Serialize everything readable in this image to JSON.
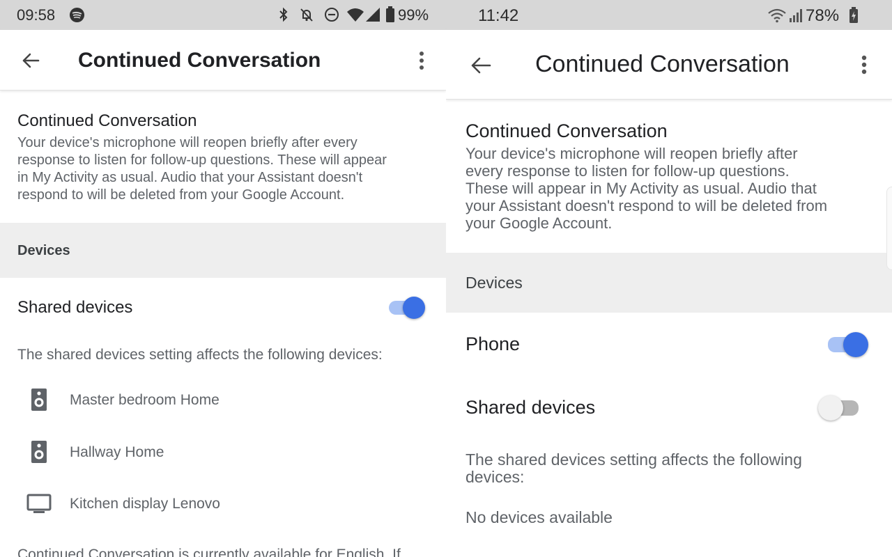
{
  "left": {
    "status": {
      "time": "09:58",
      "battery": "99%"
    },
    "toolbar": {
      "title": "Continued Conversation"
    },
    "section": {
      "heading": "Continued Conversation",
      "description_lines": [
        "Your device's microphone will reopen briefly after every",
        "response to listen for follow-up questions. These will appear",
        "in My Activity as usual. Audio that your Assistant doesn't",
        "respond to will be deleted from your Google Account."
      ]
    },
    "devices_header": "Devices",
    "shared_devices": {
      "label": "Shared devices",
      "enabled": true
    },
    "affects_text": "The shared devices setting affects the following devices:",
    "device_list": [
      {
        "name": "Master bedroom Home",
        "icon": "speaker-icon"
      },
      {
        "name": "Hallway Home",
        "icon": "speaker-icon"
      },
      {
        "name": "Kitchen display Lenovo",
        "icon": "display-icon"
      }
    ],
    "footer_partial": "Continued Conversation is currently available for English. If"
  },
  "right": {
    "status": {
      "time": "11:42",
      "battery": "78%"
    },
    "toolbar": {
      "title": "Continued Conversation"
    },
    "section": {
      "heading": "Continued Conversation",
      "description_lines": [
        "Your device's microphone will reopen briefly after",
        "every response to listen for follow-up questions.",
        "These will appear in My Activity as usual. Audio that",
        "your Assistant doesn't respond to will be deleted from",
        "your Google Account."
      ]
    },
    "devices_header": "Devices",
    "phone": {
      "label": "Phone",
      "enabled": true
    },
    "shared_devices": {
      "label": "Shared devices",
      "enabled": false
    },
    "affects_lines": [
      "The shared devices setting affects the following",
      "devices:"
    ],
    "no_devices": "No devices available"
  },
  "colors": {
    "toggle_on_thumb": "#3a6fe4",
    "toggle_on_track": "#a8c2f5",
    "toggle_off_thumb": "#f1f1f1",
    "toggle_off_track": "#b6b6b6",
    "section_band": "#eeeeee",
    "status_bar": "#d7d7d7"
  }
}
